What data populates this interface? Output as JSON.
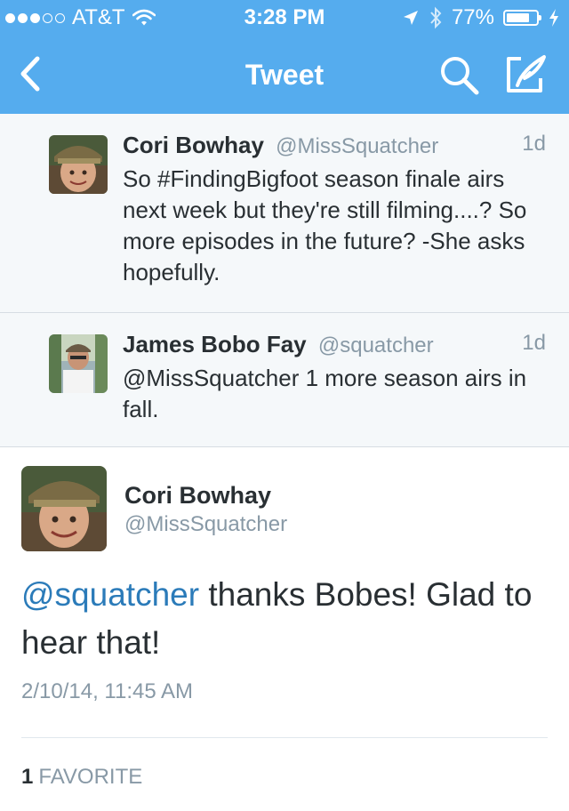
{
  "status_bar": {
    "carrier": "AT&T",
    "time": "3:28 PM",
    "battery": "77%",
    "battery_level": 0.77,
    "signal_filled": 3,
    "signal_total": 5
  },
  "nav": {
    "title": "Tweet",
    "back_icon": "chevron-left-icon",
    "search_icon": "search-icon",
    "compose_icon": "compose-tweet-icon"
  },
  "conversation": [
    {
      "name": "Cori Bowhay",
      "handle": "@MissSquatcher",
      "time": "1d",
      "text": "So #FindingBigfoot season finale airs next week but they're still filming....? So more episodes in the future? -She asks hopefully."
    },
    {
      "name": "James Bobo Fay",
      "handle": "@squatcher",
      "time": "1d",
      "text": "@MissSquatcher 1 more season airs in fall."
    }
  ],
  "main_tweet": {
    "name": "Cori Bowhay",
    "handle": "@MissSquatcher",
    "mention": "@squatcher",
    "text_rest": " thanks Bobes! Glad to hear that!",
    "timestamp": "2/10/14, 11:45 AM",
    "favorites_count": "1",
    "favorites_label": "FAVORITE"
  },
  "colors": {
    "header": "#55acee",
    "link": "#2b7bb9",
    "muted": "#8899a6"
  }
}
